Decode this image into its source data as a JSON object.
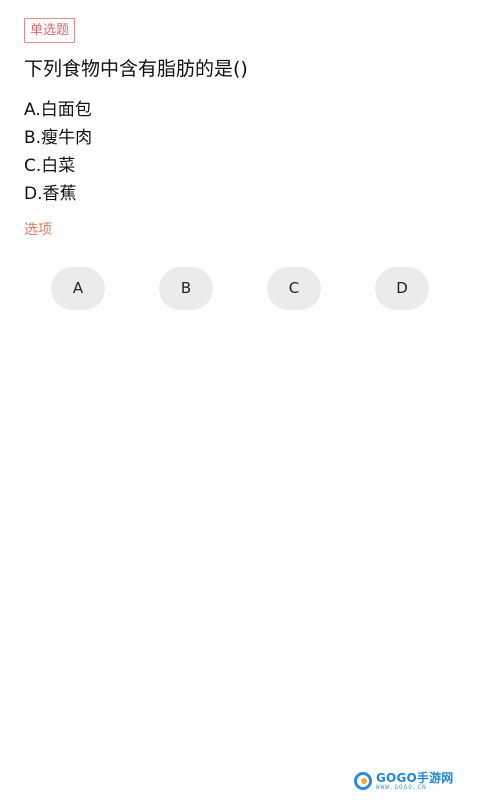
{
  "question": {
    "type_tag": "单选题",
    "text": "下列食物中含有脂肪的是()",
    "options": [
      "A.白面包",
      "B.瘦牛肉",
      "C.白菜",
      "D.香蕉"
    ]
  },
  "answer_section": {
    "label": "选项",
    "buttons": [
      "A",
      "B",
      "C",
      "D"
    ]
  },
  "watermark": {
    "name": "GOGO手游网",
    "url": "WWW.GOGO.CN",
    "icon": "gogo-logo-icon"
  },
  "colors": {
    "accent": "#e06a6a",
    "options_label": "#e07a5f",
    "button_bg": "#ebebed",
    "watermark": "#1f87d6"
  }
}
